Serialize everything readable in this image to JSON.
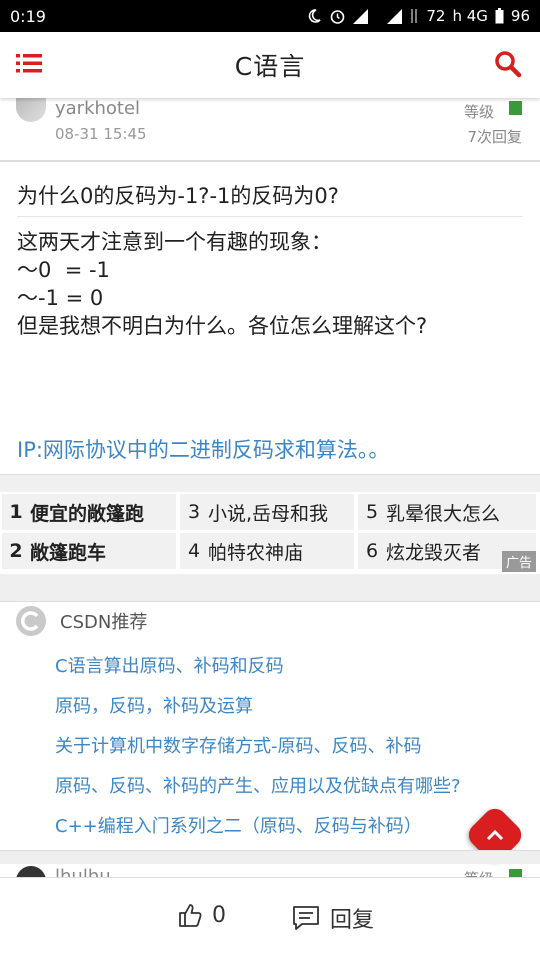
{
  "status_bar": {
    "time": "0:19",
    "battery": "72",
    "network": "h 4G",
    "battery2": "96"
  },
  "app_bar": {
    "title": "C语言",
    "menu_icon": "list-menu-icon",
    "search_icon": "search-icon"
  },
  "post": {
    "username": "yarkhotel",
    "timestamp": "08-31 15:45",
    "level_label": "等级",
    "reply_count": "7次回复",
    "title": "为什么0的反码为-1?-1的反码为0?",
    "body_lines": [
      "这两天才注意到一个有趣的现象：",
      "～0  = -1",
      "～-1 = 0",
      "但是我想不明白为什么。各位怎么理解这个?"
    ],
    "link": "IP:网际协议中的二进制反码求和算法。。"
  },
  "ads": {
    "items": [
      {
        "num": "1",
        "text": "便宜的敞篷跑"
      },
      {
        "num": "2",
        "text": "敞篷跑车"
      },
      {
        "num": "3",
        "text": "小说,岳母和我"
      },
      {
        "num": "4",
        "text": "帕特农神庙"
      },
      {
        "num": "5",
        "text": "乳晕很大怎么"
      },
      {
        "num": "6",
        "text": "炫龙毁灭者"
      }
    ],
    "tag": "广告"
  },
  "recommend": {
    "title": "CSDN推荐",
    "items": [
      "C语言算出原码、补码和反码",
      "原码，反码，补码及运算",
      "关于计算机中数字存储方式-原码、反码、补码",
      "原码、反码、补码的产生、应用以及优缺点有哪些?",
      "C++编程入门系列之二（原码、反码与补码）"
    ]
  },
  "next_post": {
    "username": "lhulhu",
    "level_label": "等级"
  },
  "bottom_bar": {
    "like_count": "0",
    "reply_label": "回复"
  },
  "colors": {
    "accent": "#d81e1e",
    "link": "#3d86c6",
    "level_badge": "#3a9a3a"
  }
}
